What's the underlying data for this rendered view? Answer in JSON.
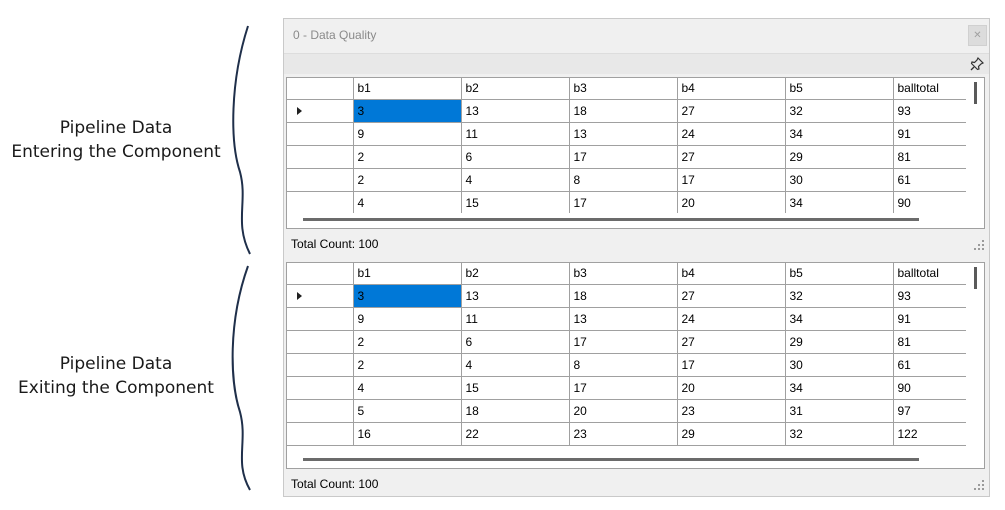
{
  "annotations": {
    "entering": [
      "Pipeline Data",
      "Entering the Component"
    ],
    "exiting": [
      "Pipeline Data",
      "Exiting the Component"
    ]
  },
  "window": {
    "title": "0 - Data Quality",
    "close_icon": "close-icon",
    "pin_icon": "pin-icon"
  },
  "columns": [
    "b1",
    "b2",
    "b3",
    "b4",
    "b5",
    "balltotal"
  ],
  "top_grid": {
    "rows": [
      [
        "3",
        "13",
        "18",
        "27",
        "32",
        "93"
      ],
      [
        "9",
        "11",
        "13",
        "24",
        "34",
        "91"
      ],
      [
        "2",
        "6",
        "17",
        "27",
        "29",
        "81"
      ],
      [
        "2",
        "4",
        "8",
        "17",
        "30",
        "61"
      ],
      [
        "4",
        "15",
        "17",
        "20",
        "34",
        "90"
      ]
    ],
    "status": "Total Count: 100"
  },
  "bottom_grid": {
    "rows": [
      [
        "3",
        "13",
        "18",
        "27",
        "32",
        "93"
      ],
      [
        "9",
        "11",
        "13",
        "24",
        "34",
        "91"
      ],
      [
        "2",
        "6",
        "17",
        "27",
        "29",
        "81"
      ],
      [
        "2",
        "4",
        "8",
        "17",
        "30",
        "61"
      ],
      [
        "4",
        "15",
        "17",
        "20",
        "34",
        "90"
      ],
      [
        "5",
        "18",
        "20",
        "23",
        "31",
        "97"
      ],
      [
        "16",
        "22",
        "23",
        "29",
        "32",
        "122"
      ]
    ],
    "status": "Total Count: 100"
  },
  "colors": {
    "selection": "#0078d7",
    "brace": "#1f2f4a"
  }
}
